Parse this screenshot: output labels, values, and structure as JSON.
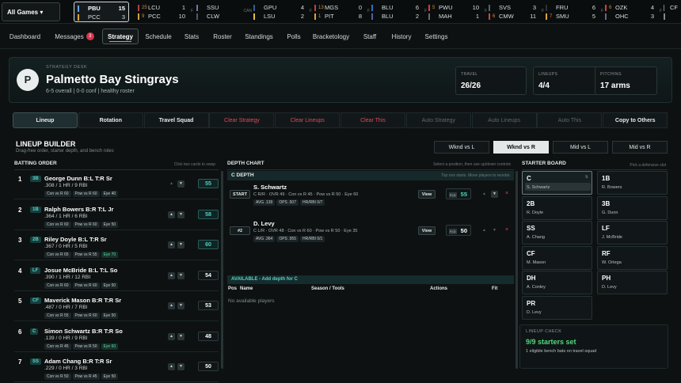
{
  "scoreboard": {
    "selector": "All Games ▾",
    "games": [
      {
        "a": "PBU",
        "as": "15",
        "b": "PCC",
        "bs": "3",
        "a_color": "#6aa0d8",
        "b_color": "#d9a23a",
        "a_rank": "",
        "b_rank": "",
        "status": "",
        "sel": true
      },
      {
        "a": "LCU",
        "as": "1",
        "b": "PCC",
        "bs": "10",
        "a_color": "#b04050",
        "b_color": "#d9a23a",
        "a_rank": "25",
        "b_rank": "9",
        "status": "F"
      },
      {
        "a": "SSU",
        "as": "",
        "b": "CLW",
        "bs": "",
        "a_color": "#6a7c9a",
        "b_color": "#4b5a70",
        "a_rank": "",
        "b_rank": "",
        "status": "CAN"
      },
      {
        "a": "GPU",
        "as": "4",
        "b": "LSU",
        "bs": "2",
        "a_color": "#3a5a8a",
        "b_color": "#e0c040",
        "a_rank": "",
        "b_rank": "",
        "status": "F"
      },
      {
        "a": "MGS",
        "as": "0",
        "b": "PIT",
        "bs": "8",
        "a_color": "#c04040",
        "b_color": "#e0a030",
        "a_rank": "13",
        "b_rank": "1",
        "status": "F"
      },
      {
        "a": "BLU",
        "as": "6",
        "b": "BLU",
        "bs": "2",
        "a_color": "#3070c0",
        "b_color": "#5060a0",
        "a_rank": "",
        "b_rank": "",
        "status": "F"
      },
      {
        "a": "PWU",
        "as": "10",
        "b": "MAH",
        "bs": "1",
        "a_color": "#d04040",
        "b_color": "#606c80",
        "a_rank": "5",
        "b_rank": "",
        "status": "F"
      },
      {
        "a": "SVS",
        "as": "3",
        "b": "CMW",
        "bs": "11",
        "a_color": "#5a6070",
        "b_color": "#d84040",
        "a_rank": "",
        "b_rank": "6",
        "status": "F"
      },
      {
        "a": "FRU",
        "as": "6",
        "b": "SMU",
        "bs": "5",
        "a_color": "#303030",
        "b_color": "#e0a040",
        "a_rank": "",
        "b_rank": "7",
        "status": "F"
      },
      {
        "a": "OZK",
        "as": "4",
        "b": "OHC",
        "bs": "3",
        "a_color": "#d04040",
        "b_color": "#606c80",
        "a_rank": "6",
        "b_rank": "",
        "status": "F"
      },
      {
        "a": "CF",
        "as": "",
        "b": "",
        "bs": "",
        "a_color": "#808890",
        "b_color": "#808890",
        "a_rank": "",
        "b_rank": "",
        "status": ""
      }
    ]
  },
  "nav": {
    "items": [
      "Dashboard",
      "Messages",
      "Strategy",
      "Schedule",
      "Stats",
      "Roster",
      "Standings",
      "Polls",
      "Bracketology",
      "Staff",
      "History",
      "Settings"
    ],
    "messages_badge": "3"
  },
  "header": {
    "eyebrow": "STRATEGY DESK",
    "logo": "P",
    "team": "Palmetto Bay Stingrays",
    "sub": "6-5 overall | 0-0 conf | healthy roster",
    "stats": [
      {
        "label": "TRAVEL",
        "value": "26/26"
      },
      {
        "label": "LINEUPS",
        "value": "4/4"
      },
      {
        "label": "PITCHING",
        "value": "17 arms"
      }
    ]
  },
  "actions": [
    "Lineup",
    "Rotation",
    "Travel Squad",
    "Clear Strategy",
    "Clear Lineups",
    "Clear This",
    "Auto Strategy",
    "Auto Lineups",
    "Auto This",
    "Copy to Others"
  ],
  "builder": {
    "title": "LINEUP BUILDER",
    "sub": "Drag-free order, starter depth, and bench roles",
    "vs": [
      "Wknd vs L",
      "Wknd vs R",
      "Mid vs L",
      "Mid vs R"
    ]
  },
  "batting": {
    "title": "BATTING ORDER",
    "hint": "Click two cards to swap",
    "rows": [
      {
        "n": "1",
        "pos": "3B",
        "name": "George Dunn",
        "bt": "B:L T:R",
        "yr": "Sr",
        "line": ".308 / 1 HR / 9 RBI",
        "tags": [
          "Con vs R 60",
          "Pow vs R 60",
          "Eye 40"
        ],
        "score": "55",
        "teal": true
      },
      {
        "n": "2",
        "pos": "1B",
        "name": "Ralph Bowers",
        "bt": "B:R T:L",
        "yr": "Jr",
        "line": ".364 / 1 HR / 6 RBI",
        "tags": [
          "Con vs R 60",
          "Pow vs R 60",
          "Eye 50"
        ],
        "score": "58",
        "teal": true
      },
      {
        "n": "3",
        "pos": "2B",
        "name": "Riley Doyle",
        "bt": "B:L T:R",
        "yr": "Sr",
        "line": ".367 / 0 HR / 5 RBI",
        "tags": [
          "Con vs R 65",
          "Pow vs R 55",
          "Eye 70"
        ],
        "score": "60",
        "teal": true
      },
      {
        "n": "4",
        "pos": "LF",
        "name": "Josue McBride",
        "bt": "B:L T:L",
        "yr": "So",
        "line": ".390 / 1 HR / 12 RBI",
        "tags": [
          "Con vs R 60",
          "Pow vs R 60",
          "Eye 50"
        ],
        "score": "54",
        "teal": false
      },
      {
        "n": "5",
        "pos": "CF",
        "name": "Maverick Mason",
        "bt": "B:R T:R",
        "yr": "Sr",
        "line": ".487 / 0 HR / 7 RBI",
        "tags": [
          "Con vs R 55",
          "Pow vs R 60",
          "Eye 50"
        ],
        "score": "53",
        "teal": false
      },
      {
        "n": "6",
        "pos": "C",
        "name": "Simon Schwartz",
        "bt": "B:R T:R",
        "yr": "So",
        "line": ".139 / 0 HR / 9 RBI",
        "tags": [
          "Con vs R 45",
          "Pow vs R 50",
          "Eye 60"
        ],
        "score": "48",
        "teal": false
      },
      {
        "n": "7",
        "pos": "SS",
        "name": "Adam Chang",
        "bt": "B:R T:R",
        "yr": "Sr",
        "line": ".229 / 0 HR / 3 RBI",
        "tags": [
          "Con vs R 50",
          "Pow vs R 45",
          "Eye 50"
        ],
        "score": "50",
        "teal": false
      }
    ]
  },
  "depth": {
    "title": "DEPTH CHART",
    "hint": "Select a position, then use up/down controls",
    "section": "C DEPTH",
    "section_hint": "Top row starts. Move players to reorder.",
    "rows": [
      {
        "role": "START",
        "name": "S. Schwartz",
        "meta": "C R/R · OVR 49 · Con vs R 45 · Pow vs R 50 · Eye 60",
        "tags": [
          "AVG .139",
          "OPS .507",
          "HR/RBI 0/7"
        ],
        "view": "View",
        "fld": "FLD",
        "fv": "55",
        "teal": true
      },
      {
        "role": "#2",
        "name": "D. Levy",
        "meta": "C L/R · OVR 48 · Con vs R 60 · Pow vs R 50 · Eye 35",
        "tags": [
          "AVG .364",
          "OPS .955",
          "HR/RBI 0/1"
        ],
        "view": "View",
        "fld": "FLD",
        "fv": "50",
        "teal": false
      }
    ],
    "avail": "AVAILABLE - Add depth for C",
    "cols": [
      "Pos",
      "Name",
      "Season / Tools",
      "Actions",
      "Fit"
    ],
    "none": "No available players"
  },
  "starters": {
    "title": "STARTER BOARD",
    "hint": "Pick a defensive slot",
    "slots": [
      {
        "pos": "C",
        "name": "S. Schwartz",
        "active": true
      },
      {
        "pos": "1B",
        "name": "R. Bowers"
      },
      {
        "pos": "2B",
        "name": "R. Doyle"
      },
      {
        "pos": "3B",
        "name": "G. Dunn"
      },
      {
        "pos": "SS",
        "name": "A. Chang"
      },
      {
        "pos": "LF",
        "name": "J. McBride"
      },
      {
        "pos": "CF",
        "name": "M. Mason"
      },
      {
        "pos": "RF",
        "name": "W. Ortega"
      },
      {
        "pos": "DH",
        "name": "A. Conley"
      },
      {
        "pos": "PH",
        "name": "D. Levy"
      },
      {
        "pos": "PR",
        "name": "D. Levy"
      }
    ],
    "check_label": "LINEUP CHECK",
    "check_value": "9/9 starters set",
    "check_sub": "1 eligible bench bats on travel squad"
  },
  "colors": {
    "accent": "#d4a437",
    "teal": "#4fd0bf",
    "red": "#e0485c",
    "green": "#53d77e"
  }
}
